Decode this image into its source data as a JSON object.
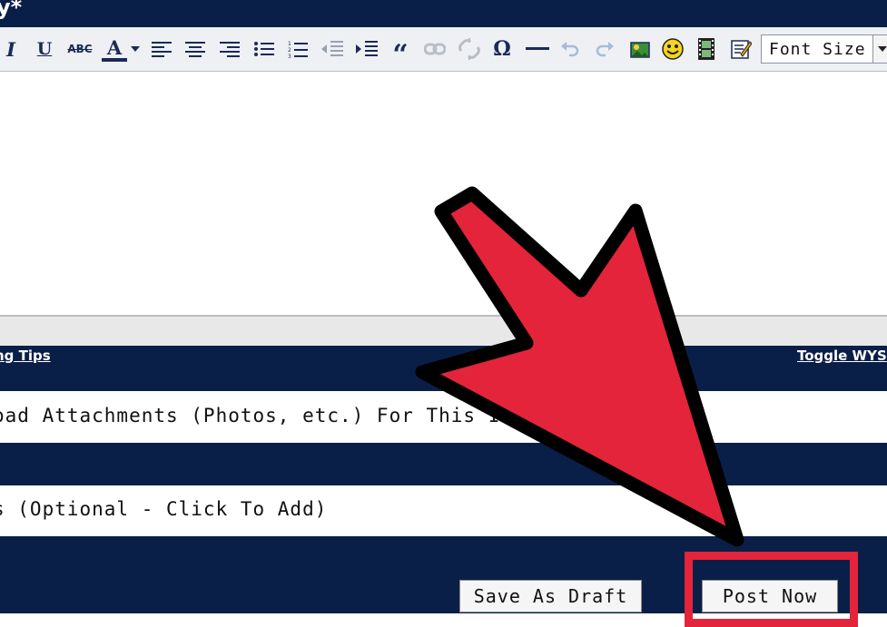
{
  "window": {
    "title": "y*"
  },
  "toolbar": {
    "buttons": [
      "italic",
      "underline",
      "strikethrough",
      "font-color",
      "align-left",
      "align-center",
      "align-right",
      "bullet-list",
      "numbered-list",
      "outdent",
      "indent",
      "quote",
      "link",
      "unlink",
      "special-character",
      "horizontal-rule",
      "undo",
      "redo",
      "insert-image",
      "smiley",
      "insert-video",
      "spellcheck"
    ],
    "italic_label": "I",
    "underline_label": "U",
    "strike_label": "ABC",
    "font_color_label": "A",
    "omega_label": "Ω",
    "quote_label": "“",
    "font_size": {
      "selected": "Font Size"
    }
  },
  "links": {
    "tips": "ng Tips",
    "toggle": "Toggle WYS"
  },
  "sections": {
    "attachments": "oad Attachments (Photos, etc.) For This I",
    "tags": "s (Optional - Click To Add)"
  },
  "actions": {
    "save_draft": "Save As Draft",
    "post_now": "Post Now"
  },
  "colors": {
    "navy": "#0a1f47",
    "annotation_red": "#e3243b"
  }
}
